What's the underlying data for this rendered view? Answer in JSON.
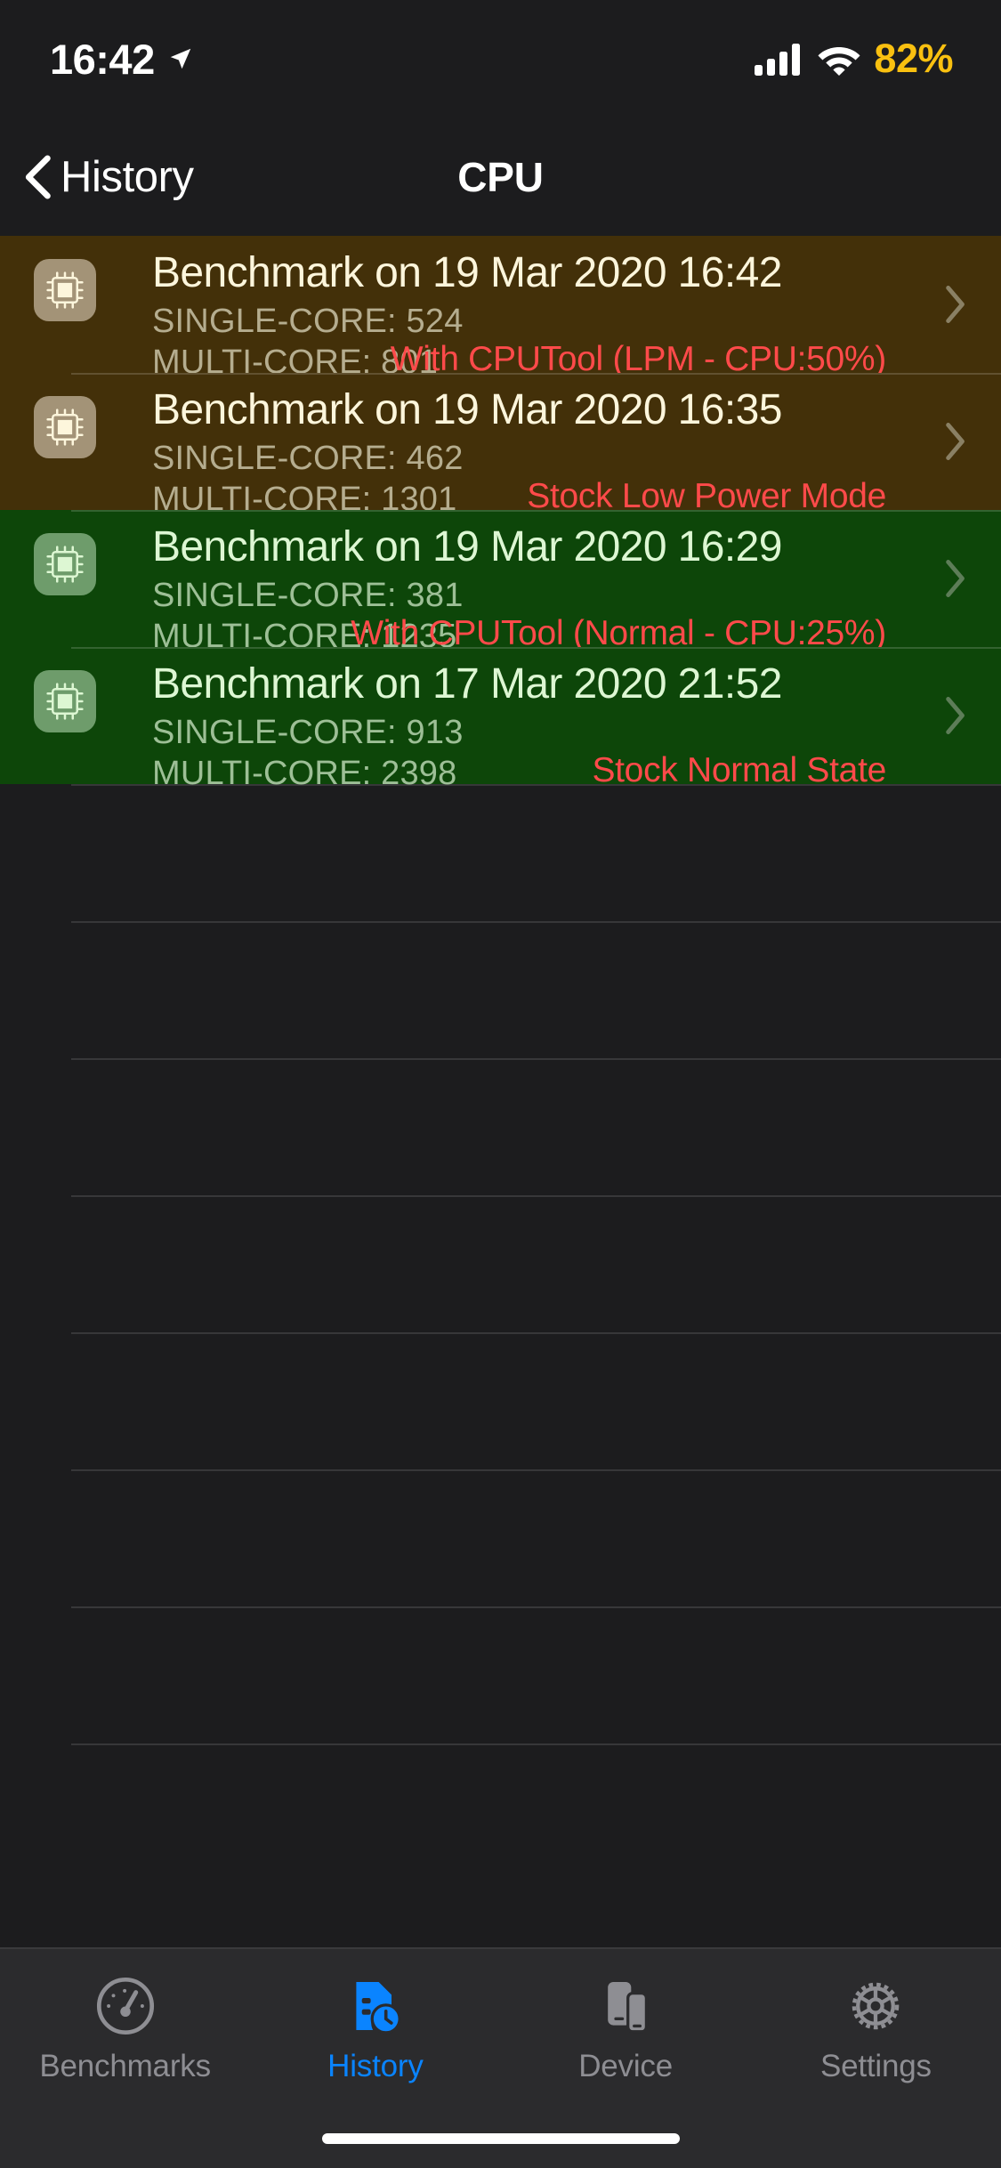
{
  "status_bar": {
    "time": "16:42",
    "location_icon": "location-arrow-icon",
    "cellular_icon": "cellular-bars-icon",
    "wifi_icon": "wifi-icon",
    "battery_percent": "82%",
    "battery_color": "#f9c010"
  },
  "nav_bar": {
    "back_label": "History",
    "back_icon": "chevron-left-icon",
    "title": "CPU"
  },
  "list": {
    "rows": [
      {
        "icon": "cpu-chip-icon",
        "title": "Benchmark on 19 Mar 2020 16:42",
        "single_core_label": "SINGLE-CORE:",
        "single_core_value": "524",
        "single_core": "SINGLE-CORE: 524",
        "multi_core_label": "MULTI-CORE:",
        "multi_core_value": "801",
        "multi_core": "MULTI-CORE: 801",
        "note": "With CPUTool (LPM - CPU:50%)",
        "accent": "#433009",
        "theme": "olive"
      },
      {
        "icon": "cpu-chip-icon",
        "title": "Benchmark on 19 Mar 2020 16:35",
        "single_core_label": "SINGLE-CORE:",
        "single_core_value": "462",
        "single_core": "SINGLE-CORE: 462",
        "multi_core_label": "MULTI-CORE:",
        "multi_core_value": "1301",
        "multi_core": "MULTI-CORE: 1301",
        "note": "Stock Low Power Mode",
        "accent": "#433009",
        "theme": "olive"
      },
      {
        "icon": "cpu-chip-icon",
        "title": "Benchmark on 19 Mar 2020 16:29",
        "single_core_label": "SINGLE-CORE:",
        "single_core_value": "381",
        "single_core": "SINGLE-CORE: 381",
        "multi_core_label": "MULTI-CORE:",
        "multi_core_value": "1235",
        "multi_core": "MULTI-CORE: 1235",
        "note": "With CPUTool (Normal - CPU:25%)",
        "accent": "#0d4609",
        "theme": "green"
      },
      {
        "icon": "cpu-chip-icon",
        "title": "Benchmark on 17 Mar 2020 21:52",
        "single_core_label": "SINGLE-CORE:",
        "single_core_value": "913",
        "single_core": "SINGLE-CORE: 913",
        "multi_core_label": "MULTI-CORE:",
        "multi_core_value": "2398",
        "multi_core": "MULTI-CORE: 2398",
        "note": "Stock Normal State",
        "accent": "#0d4609",
        "theme": "green"
      }
    ],
    "disclosure_icon": "chevron-right-icon",
    "note_color": "#ff4a4a"
  },
  "tab_bar": {
    "active_color": "#0a84ff",
    "inactive_color": "#8e8e93",
    "tabs": [
      {
        "label": "Benchmarks",
        "icon": "speedometer-icon",
        "active": false
      },
      {
        "label": "History",
        "icon": "document-clock-icon",
        "active": true
      },
      {
        "label": "Device",
        "icon": "devices-icon",
        "active": false
      },
      {
        "label": "Settings",
        "icon": "gear-icon",
        "active": false
      }
    ]
  },
  "home_indicator": "home-indicator-bar"
}
